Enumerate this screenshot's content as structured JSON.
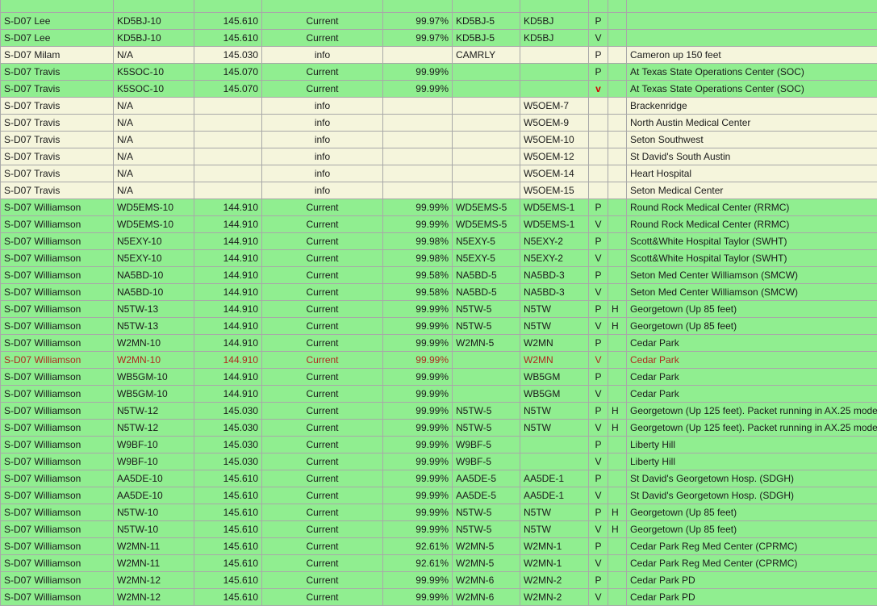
{
  "rows": [
    {
      "style": "green",
      "site": "",
      "call": "",
      "freq": "",
      "type": "",
      "pct": "",
      "digi": "",
      "alias": "",
      "pv": "",
      "h": "",
      "note": ""
    },
    {
      "style": "green",
      "site": "S-D07 Lee",
      "call": "KD5BJ-10",
      "freq": "145.610",
      "type": "Current",
      "pct": "99.97%",
      "digi": "KD5BJ-5",
      "alias": "KD5BJ",
      "pv": "P",
      "h": "",
      "note": ""
    },
    {
      "style": "green",
      "site": "S-D07 Lee",
      "call": "KD5BJ-10",
      "freq": "145.610",
      "type": "Current",
      "pct": "99.97%",
      "digi": "KD5BJ-5",
      "alias": "KD5BJ",
      "pv": "V",
      "h": "",
      "note": ""
    },
    {
      "style": "cream",
      "site": "S-D07 Milam",
      "call": "N/A",
      "freq": "145.030",
      "type": "info",
      "pct": "",
      "digi": "CAMRLY",
      "alias": "",
      "pv": "P",
      "h": "",
      "note": "Cameron up 150 feet"
    },
    {
      "style": "green",
      "site": "S-D07 Travis",
      "call": "K5SOC-10",
      "freq": "145.070",
      "type": "Current",
      "pct": "99.99%",
      "digi": "",
      "alias": "",
      "pv": "P",
      "h": "",
      "note": "At Texas State Operations Center (SOC)"
    },
    {
      "style": "green",
      "site": "S-D07 Travis",
      "call": "K5SOC-10",
      "freq": "145.070",
      "type": "Current",
      "pct": "99.99%",
      "digi": "",
      "alias": "",
      "pv": "v",
      "pvRed": true,
      "h": "",
      "note": "At Texas State Operations Center (SOC)"
    },
    {
      "style": "cream",
      "site": "S-D07 Travis",
      "call": "N/A",
      "freq": "",
      "type": "info",
      "pct": "",
      "digi": "",
      "alias": "W5OEM-7",
      "pv": "",
      "h": "",
      "note": "Brackenridge"
    },
    {
      "style": "cream",
      "site": "S-D07 Travis",
      "call": "N/A",
      "freq": "",
      "type": "info",
      "pct": "",
      "digi": "",
      "alias": "W5OEM-9",
      "pv": "",
      "h": "",
      "note": "North Austin Medical Center"
    },
    {
      "style": "cream",
      "site": "S-D07 Travis",
      "call": "N/A",
      "freq": "",
      "type": "info",
      "pct": "",
      "digi": "",
      "alias": "W5OEM-10",
      "pv": "",
      "h": "",
      "note": "Seton Southwest"
    },
    {
      "style": "cream",
      "site": "S-D07 Travis",
      "call": "N/A",
      "freq": "",
      "type": "info",
      "pct": "",
      "digi": "",
      "alias": "W5OEM-12",
      "pv": "",
      "h": "",
      "note": "St David's South Austin"
    },
    {
      "style": "cream",
      "site": "S-D07 Travis",
      "call": "N/A",
      "freq": "",
      "type": "info",
      "pct": "",
      "digi": "",
      "alias": "W5OEM-14",
      "pv": "",
      "h": "",
      "note": "Heart Hospital"
    },
    {
      "style": "cream",
      "site": "S-D07 Travis",
      "call": "N/A",
      "freq": "",
      "type": "info",
      "pct": "",
      "digi": "",
      "alias": "W5OEM-15",
      "pv": "",
      "h": "",
      "note": "Seton Medical Center"
    },
    {
      "style": "green",
      "site": "S-D07 Williamson",
      "call": "WD5EMS-10",
      "freq": "144.910",
      "type": "Current",
      "pct": "99.99%",
      "digi": "WD5EMS-5",
      "alias": "WD5EMS-1",
      "pv": "P",
      "h": "",
      "note": "Round Rock Medical Center (RRMC)"
    },
    {
      "style": "green",
      "site": "S-D07 Williamson",
      "call": "WD5EMS-10",
      "freq": "144.910",
      "type": "Current",
      "pct": "99.99%",
      "digi": "WD5EMS-5",
      "alias": "WD5EMS-1",
      "pv": "V",
      "h": "",
      "note": "Round Rock Medical Center (RRMC)"
    },
    {
      "style": "green",
      "site": "S-D07 Williamson",
      "call": "N5EXY-10",
      "freq": "144.910",
      "type": "Current",
      "pct": "99.98%",
      "digi": "N5EXY-5",
      "alias": "N5EXY-2",
      "pv": "P",
      "h": "",
      "note": "Scott&White Hospital Taylor (SWHT)"
    },
    {
      "style": "green",
      "site": "S-D07 Williamson",
      "call": "N5EXY-10",
      "freq": "144.910",
      "type": "Current",
      "pct": "99.98%",
      "digi": "N5EXY-5",
      "alias": "N5EXY-2",
      "pv": "V",
      "h": "",
      "note": "Scott&White Hospital Taylor (SWHT)"
    },
    {
      "style": "green",
      "site": "S-D07 Williamson",
      "call": "NA5BD-10",
      "freq": "144.910",
      "type": "Current",
      "pct": "99.58%",
      "digi": "NA5BD-5",
      "alias": "NA5BD-3",
      "pv": "P",
      "h": "",
      "note": "Seton Med Center Williamson (SMCW)"
    },
    {
      "style": "green",
      "site": "S-D07 Williamson",
      "call": "NA5BD-10",
      "freq": "144.910",
      "type": "Current",
      "pct": "99.58%",
      "digi": "NA5BD-5",
      "alias": "NA5BD-3",
      "pv": "V",
      "h": "",
      "note": "Seton Med Center Williamson (SMCW)"
    },
    {
      "style": "green",
      "site": "S-D07 Williamson",
      "call": "N5TW-13",
      "freq": "144.910",
      "type": "Current",
      "pct": "99.99%",
      "digi": "N5TW-5",
      "alias": "N5TW",
      "pv": "P",
      "h": "H",
      "note": "Georgetown (Up 85 feet)"
    },
    {
      "style": "green",
      "site": "S-D07 Williamson",
      "call": "N5TW-13",
      "freq": "144.910",
      "type": "Current",
      "pct": "99.99%",
      "digi": "N5TW-5",
      "alias": "N5TW",
      "pv": "V",
      "h": "H",
      "note": "Georgetown (Up 85 feet)"
    },
    {
      "style": "green",
      "site": "S-D07 Williamson",
      "call": "W2MN-10",
      "freq": "144.910",
      "type": "Current",
      "pct": "99.99%",
      "digi": "W2MN-5",
      "alias": "W2MN",
      "pv": "P",
      "h": "",
      "note": "Cedar Park"
    },
    {
      "style": "green",
      "alert": true,
      "site": "S-D07 Williamson",
      "call": "W2MN-10",
      "freq": "144.910",
      "type": "Current",
      "pct": "99.99%",
      "digi": "",
      "alias": "W2MN",
      "pv": "V",
      "h": "",
      "note": "Cedar Park"
    },
    {
      "style": "green",
      "site": "S-D07 Williamson",
      "call": "WB5GM-10",
      "freq": "144.910",
      "type": "Current",
      "pct": "99.99%",
      "digi": "",
      "alias": "WB5GM",
      "pv": "P",
      "h": "",
      "note": "Cedar Park"
    },
    {
      "style": "green",
      "site": "S-D07 Williamson",
      "call": "WB5GM-10",
      "freq": "144.910",
      "type": "Current",
      "pct": "99.99%",
      "digi": "",
      "alias": "WB5GM",
      "pv": "V",
      "h": "",
      "note": "Cedar Park"
    },
    {
      "style": "green",
      "site": "S-D07 Williamson",
      "call": "N5TW-12",
      "freq": "145.030",
      "type": "Current",
      "pct": "99.99%",
      "digi": "N5TW-5",
      "alias": "N5TW",
      "pv": "P",
      "h": "H",
      "note": "Georgetown (Up 125 feet). Packet running in AX.25 mode"
    },
    {
      "style": "green",
      "site": "S-D07 Williamson",
      "call": "N5TW-12",
      "freq": "145.030",
      "type": "Current",
      "pct": "99.99%",
      "digi": "N5TW-5",
      "alias": "N5TW",
      "pv": "V",
      "h": "H",
      "note": "Georgetown (Up 125 feet). Packet running in AX.25 mode"
    },
    {
      "style": "green",
      "site": "S-D07 Williamson",
      "call": "W9BF-10",
      "freq": "145.030",
      "type": "Current",
      "pct": "99.99%",
      "digi": "W9BF-5",
      "alias": "",
      "pv": "P",
      "h": "",
      "note": "Liberty Hill"
    },
    {
      "style": "green",
      "site": "S-D07 Williamson",
      "call": "W9BF-10",
      "freq": "145.030",
      "type": "Current",
      "pct": "99.99%",
      "digi": "W9BF-5",
      "alias": "",
      "pv": "V",
      "h": "",
      "note": "Liberty Hill"
    },
    {
      "style": "green",
      "site": "S-D07 Williamson",
      "call": "AA5DE-10",
      "freq": "145.610",
      "type": "Current",
      "pct": "99.99%",
      "digi": "AA5DE-5",
      "alias": "AA5DE-1",
      "pv": "P",
      "h": "",
      "note": "St David's Georgetown Hosp. (SDGH)"
    },
    {
      "style": "green",
      "site": "S-D07 Williamson",
      "call": "AA5DE-10",
      "freq": "145.610",
      "type": "Current",
      "pct": "99.99%",
      "digi": "AA5DE-5",
      "alias": "AA5DE-1",
      "pv": "V",
      "h": "",
      "note": "St David's Georgetown Hosp. (SDGH)"
    },
    {
      "style": "green",
      "site": "S-D07 Williamson",
      "call": "N5TW-10",
      "freq": "145.610",
      "type": "Current",
      "pct": "99.99%",
      "digi": "N5TW-5",
      "alias": "N5TW",
      "pv": "P",
      "h": "H",
      "note": "Georgetown (Up 85 feet)"
    },
    {
      "style": "green",
      "site": "S-D07 Williamson",
      "call": "N5TW-10",
      "freq": "145.610",
      "type": "Current",
      "pct": "99.99%",
      "digi": "N5TW-5",
      "alias": "N5TW",
      "pv": "V",
      "h": "H",
      "note": "Georgetown (Up 85 feet)"
    },
    {
      "style": "green",
      "site": "S-D07 Williamson",
      "call": "W2MN-11",
      "freq": "145.610",
      "type": "Current",
      "pct": "92.61%",
      "digi": "W2MN-5",
      "alias": "W2MN-1",
      "pv": "P",
      "h": "",
      "note": "Cedar Park Reg Med Center (CPRMC)"
    },
    {
      "style": "green",
      "site": "S-D07 Williamson",
      "call": "W2MN-11",
      "freq": "145.610",
      "type": "Current",
      "pct": "92.61%",
      "digi": "W2MN-5",
      "alias": "W2MN-1",
      "pv": "V",
      "h": "",
      "note": "Cedar Park Reg Med Center (CPRMC)"
    },
    {
      "style": "green",
      "site": "S-D07 Williamson",
      "call": "W2MN-12",
      "freq": "145.610",
      "type": "Current",
      "pct": "99.99%",
      "digi": "W2MN-6",
      "alias": "W2MN-2",
      "pv": "P",
      "h": "",
      "note": "Cedar Park PD"
    },
    {
      "style": "green",
      "site": "S-D07 Williamson",
      "call": "W2MN-12",
      "freq": "145.610",
      "type": "Current",
      "pct": "99.99%",
      "digi": "W2MN-6",
      "alias": "W2MN-2",
      "pv": "V",
      "h": "",
      "note": "Cedar Park PD"
    }
  ]
}
